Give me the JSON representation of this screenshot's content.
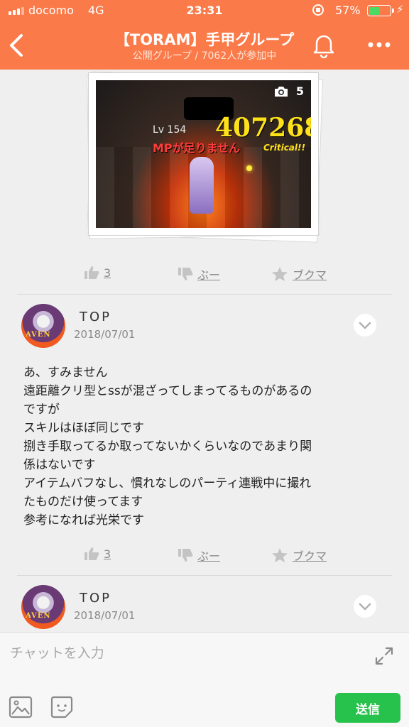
{
  "status_bar": {
    "carrier": "docomo",
    "network": "4G",
    "time": "23:31",
    "battery_percent": "57%",
    "battery_level": 0.57
  },
  "header": {
    "title": "【TORAM】手甲グループ",
    "subtitle": "公開グループ / 7062人が参加中",
    "back_icon": "chevron-left-icon",
    "bell_icon": "bell-icon",
    "more_icon": "more-dots-icon",
    "bg_color": "#fa7a49"
  },
  "post": {
    "photo_count": "5",
    "screenshot_text": {
      "level_label": "Lv 154",
      "damage": "407268",
      "mp_warning": "MPが足りません",
      "critical": "Critical!!"
    }
  },
  "post_actions": {
    "like_count": "3",
    "dislike_label": "ぶー",
    "bookmark_label": "ブクマ"
  },
  "comments": [
    {
      "user": "TOP",
      "date": "2018/07/01",
      "avatar_text": "AVEN",
      "lines": [
        "あ、すみません",
        "遠距離クリ型とssが混ざってしまってるものがあるの",
        "ですが",
        "スキルはほぼ同じです",
        "捌き手取ってるか取ってないかくらいなのであまり関",
        "係はないです",
        "アイテムバフなし、慣れなしのパーティ連戦中に撮れ",
        "たものだけ使ってます",
        "参考になれば光栄です"
      ],
      "like_count": "3",
      "dislike_label": "ぶー",
      "bookmark_label": "ブクマ"
    },
    {
      "user": "TOP",
      "date": "2018/07/01",
      "avatar_text": "AVEN"
    }
  ],
  "input_bar": {
    "placeholder": "チャットを入力",
    "send_label": "送信",
    "send_color": "#27c24c"
  }
}
